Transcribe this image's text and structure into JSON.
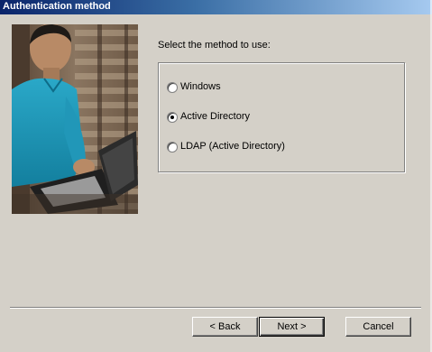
{
  "window": {
    "title": "Authentication method"
  },
  "photo": {
    "description_icon": "man-with-laptop-photo"
  },
  "prompt": "Select the method to use:",
  "methods": [
    {
      "label": "Windows",
      "selected": false
    },
    {
      "label": "Active Directory",
      "selected": true
    },
    {
      "label": "LDAP (Active Directory)",
      "selected": false
    }
  ],
  "buttons": {
    "back": "< Back",
    "next": "Next >",
    "cancel": "Cancel"
  }
}
